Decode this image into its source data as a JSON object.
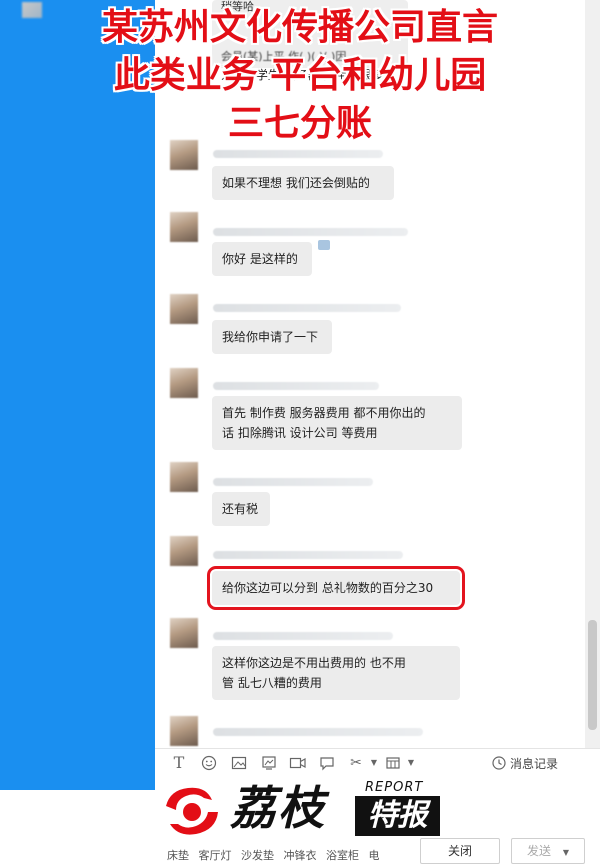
{
  "headline": {
    "line1": "某苏州文化传播公司直言",
    "line2": "此类业务 平台和幼儿园",
    "line3": "三七分账"
  },
  "chat": {
    "partial_top": {
      "line0": "稍等哈",
      "line1": "会员(某)上平  作(  )(  )(  )因",
      "line2": "为200学生 服务器 费用也很多的"
    },
    "messages": [
      {
        "text": "如果不理想 我们还会倒贴的"
      },
      {
        "text": "你好 是这样的"
      },
      {
        "text": "我给你申请了一下"
      },
      {
        "line1": "首先 制作费 服务器费用 都不用你出的",
        "line2": "话  扣除腾讯 设计公司 等费用"
      },
      {
        "text": "还有税"
      },
      {
        "text": "给你这边可以分到 总礼物数的百分之30",
        "highlighted": true
      },
      {
        "line1": "这样你这边是不用出费用的  也不用",
        "line2": "管 乱七八糟的费用"
      }
    ]
  },
  "toolbar": {
    "icons": [
      "text-format-icon",
      "emoji-icon",
      "image-icon",
      "screenshot-icon",
      "video-icon",
      "message-icon",
      "scissors-icon",
      "more-icon"
    ],
    "history_label": "消息记录"
  },
  "logo": {
    "cn": "荔枝",
    "report": "REPORT",
    "tebao": "特报",
    "color": "#e30e16"
  },
  "bottom": {
    "links": "床垫 客厅灯 沙发垫 冲锋衣 浴室柜 电",
    "close_label": "关闭",
    "send_label": "发送"
  },
  "colors": {
    "left_panel": "#1a8ff0",
    "headline": "#e30e16",
    "highlight_box": "#e3141e",
    "bubble": "#ececec"
  }
}
